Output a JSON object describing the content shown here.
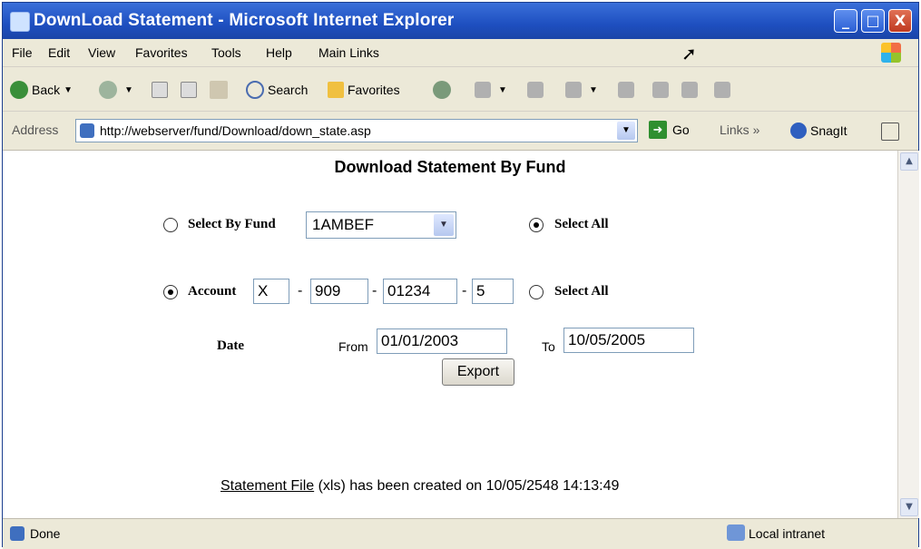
{
  "window": {
    "title": "DownLoad Statement - Microsoft Internet Explorer",
    "buttons": {
      "min": "_",
      "max": "□",
      "close": "X"
    }
  },
  "menubar": {
    "items": [
      "File",
      "Edit",
      "View",
      "Favorites",
      "Tools",
      "Help",
      "Main Links"
    ]
  },
  "toolbar": {
    "back": "Back",
    "search": "Search",
    "favorites": "Favorites"
  },
  "address": {
    "label": "Address",
    "url": "http://webserver/fund/Download/down_state.asp",
    "go": "Go",
    "links": "Links",
    "links_chevron": "»",
    "snagit": "SnagIt"
  },
  "content": {
    "title": "Download Statement By Fund",
    "fund": {
      "label": "Select By Fund",
      "selected": "1AMBEF",
      "checked": false,
      "select_all_label": "Select All",
      "select_all_checked": true
    },
    "account": {
      "label": "Account",
      "checked": true,
      "parts": [
        "X",
        "909",
        "01234",
        "5"
      ],
      "separator": "-",
      "select_all_label": "Select All",
      "select_all_checked": false
    },
    "date": {
      "label": "Date",
      "from_label": "From",
      "from_value": "01/01/2003",
      "to_label": "To",
      "to_value": "10/05/2005"
    },
    "export_button": "Export",
    "message": {
      "link": "Statement File",
      "text": " (xls) has been created on 10/05/2548 14:13:49"
    }
  },
  "statusbar": {
    "status": "Done",
    "zone": "Local intranet"
  }
}
